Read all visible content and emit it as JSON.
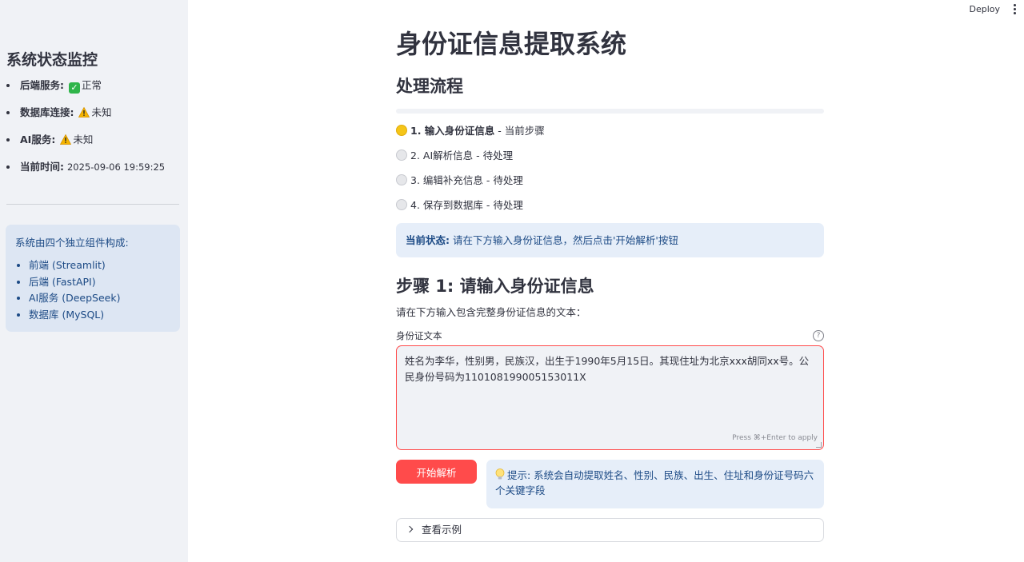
{
  "header": {
    "deploy_label": "Deploy",
    "menu_icon": "vertical-dots-icon"
  },
  "sidebar": {
    "title": "系统状态监控",
    "status": [
      {
        "key": "后端服务:",
        "icon": "check-icon",
        "value": "正常"
      },
      {
        "key": "数据库连接:",
        "icon": "warning-icon",
        "value": "未知"
      },
      {
        "key": "AI服务:",
        "icon": "warning-icon",
        "value": "未知"
      },
      {
        "key": "当前时间:",
        "value": "2025-09-06 19:59:25"
      }
    ],
    "info": {
      "text": "系统由四个独立组件构成:",
      "items": [
        "前端 (Streamlit)",
        "后端 (FastAPI)",
        "AI服务 (DeepSeek)",
        "数据库 (MySQL)"
      ]
    }
  },
  "main": {
    "title": "身份证信息提取系统",
    "section_title": "处理流程",
    "progress": 0,
    "steps": [
      {
        "icon": "yellow-circle-icon",
        "label": "1. 输入身份证信息",
        "status": "- 当前步骤"
      },
      {
        "icon": "white-circle-icon",
        "label": "2. AI解析信息",
        "status": "- 待处理"
      },
      {
        "icon": "white-circle-icon",
        "label": "3. 编辑补充信息",
        "status": "- 待处理"
      },
      {
        "icon": "white-circle-icon",
        "label": "4. 保存到数据库",
        "status": "- 待处理"
      }
    ],
    "current_status": {
      "key": "当前状态:",
      "text": "请在下方输入身份证信息，然后点击'开始解析'按钮"
    },
    "step1_title": "步骤 1: 请输入身份证信息",
    "instruction": "请在下方输入包含完整身份证信息的文本：",
    "field_label": "身份证文本",
    "textarea_value": "姓名为李华，性别男，民族汉，出生于1990年5月15日。其现住址为北京xxx胡同xx号。公民身份号码为110108199005153011X",
    "press_hint": "Press ⌘+Enter to apply",
    "parse_button": "开始解析",
    "tip": "提示: 系统会自动提取姓名、性别、民族、出生、住址和身份证号码六个关键字段",
    "expander_label": "查看示例"
  },
  "colors": {
    "primary": "#ff4b4b",
    "info_bg": "#e6eef9",
    "info_text": "#1c4a85",
    "sidebar_bg": "#f0f2f6"
  }
}
